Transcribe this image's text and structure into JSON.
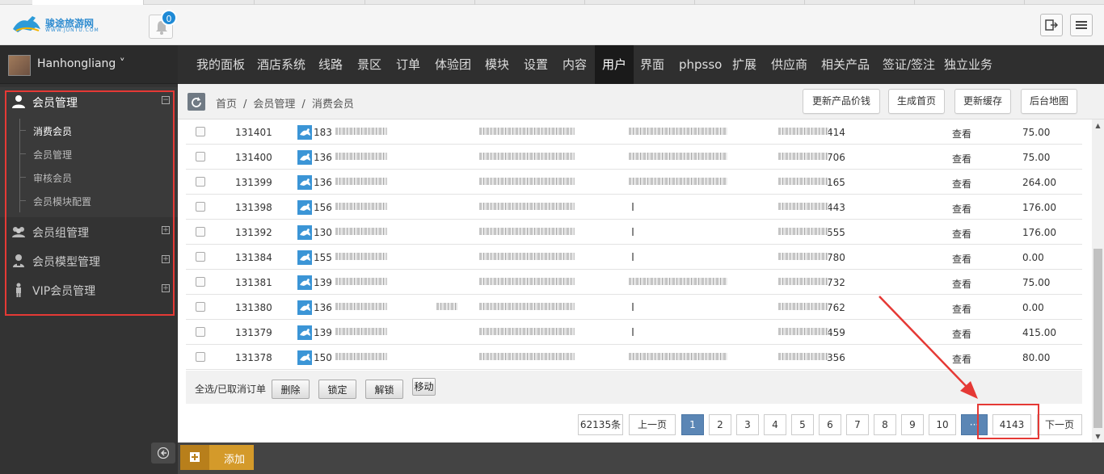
{
  "header": {
    "logo_text": "骏途旅游网",
    "logo_sub": "WWW.JUNTU.COM",
    "notification_count": "0"
  },
  "sidebar": {
    "username": "Hanhongliang",
    "groups": [
      {
        "label": "会员管理",
        "icon": "user-icon",
        "toggle": "⊟"
      },
      {
        "label": "会员组管理",
        "icon": "users-icon",
        "toggle": "⊞"
      },
      {
        "label": "会员模型管理",
        "icon": "user-model-icon",
        "toggle": "⊞"
      },
      {
        "label": "VIP会员管理",
        "icon": "vip-icon",
        "toggle": "⊞"
      }
    ],
    "subitems": [
      "消费会员",
      "会员管理",
      "审核会员",
      "会员模块配置"
    ]
  },
  "topnav": [
    "我的面板",
    "酒店系统",
    "线路",
    "景区",
    "订单",
    "体验团",
    "模块",
    "设置",
    "内容",
    "用户",
    "界面",
    "phpsso",
    "扩展",
    "供应商",
    "相关产品",
    "签证/签注",
    "独立业务"
  ],
  "breadcrumb": [
    "首页",
    "会员管理",
    "消费会员"
  ],
  "actions": [
    "更新产品价钱",
    "生成首页",
    "更新缓存",
    "后台地图"
  ],
  "rows": [
    {
      "id": "131401",
      "phone_prefix": "183",
      "phone_suffix": "414",
      "view": "查看",
      "amount": "75.00"
    },
    {
      "id": "131400",
      "phone_prefix": "136",
      "phone_suffix": "706",
      "view": "查看",
      "amount": "75.00"
    },
    {
      "id": "131399",
      "phone_prefix": "136",
      "phone_suffix": "165",
      "view": "查看",
      "amount": "264.00"
    },
    {
      "id": "131398",
      "phone_prefix": "156",
      "phone_suffix": "443",
      "view": "查看",
      "amount": "176.00"
    },
    {
      "id": "131392",
      "phone_prefix": "130",
      "phone_suffix": "555",
      "view": "查看",
      "amount": "176.00"
    },
    {
      "id": "131384",
      "phone_prefix": "155",
      "phone_suffix": "780",
      "view": "查看",
      "amount": "0.00"
    },
    {
      "id": "131381",
      "phone_prefix": "139",
      "phone_suffix": "732",
      "view": "查看",
      "amount": "75.00"
    },
    {
      "id": "131380",
      "phone_prefix": "136",
      "phone_suffix": "762",
      "view": "查看",
      "amount": "0.00"
    },
    {
      "id": "131379",
      "phone_prefix": "139",
      "phone_suffix": "459",
      "view": "查看",
      "amount": "415.00"
    },
    {
      "id": "131378",
      "phone_prefix": "150",
      "phone_suffix": "356",
      "view": "查看",
      "amount": "80.00"
    }
  ],
  "batch": {
    "select_all": "全选/已取消订单",
    "buttons": [
      "删除",
      "锁定",
      "解锁",
      "移动"
    ]
  },
  "pager": {
    "total": "62135条",
    "prev": "上一页",
    "pages": [
      "1",
      "2",
      "3",
      "4",
      "5",
      "6",
      "7",
      "8",
      "9",
      "10"
    ],
    "current": "1",
    "dots": "···",
    "last": "4143",
    "next": "下一页"
  },
  "bottom": {
    "add": "添加"
  },
  "colors": {
    "accent": "#1e8ad6",
    "highlight": "#e53935",
    "add": "#d49a2a"
  }
}
